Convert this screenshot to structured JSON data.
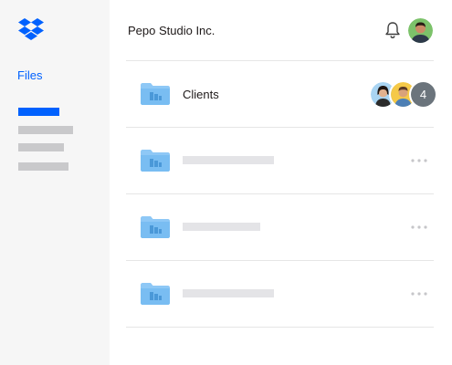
{
  "app": {
    "brand_color": "#0061fe"
  },
  "sidebar": {
    "logo_icon": "dropbox-logo-icon",
    "files_label": "Files"
  },
  "header": {
    "title": "Pepo Studio Inc.",
    "notification_icon": "bell-icon",
    "avatar": "user-avatar"
  },
  "rows": [
    {
      "name": "Clients",
      "icon": "shared-folder-icon",
      "members_more_count": "4"
    },
    {
      "name": "",
      "icon": "shared-folder-icon",
      "action_icon": "more-options-icon"
    },
    {
      "name": "",
      "icon": "shared-folder-icon",
      "action_icon": "more-options-icon"
    },
    {
      "name": "",
      "icon": "shared-folder-icon",
      "action_icon": "more-options-icon"
    }
  ]
}
